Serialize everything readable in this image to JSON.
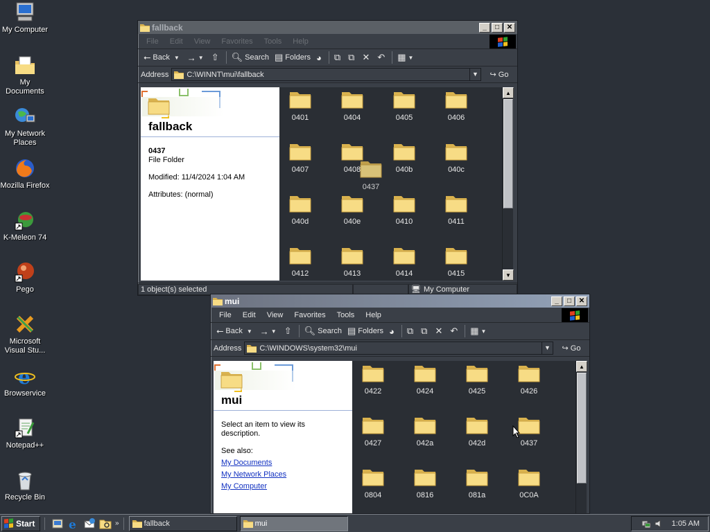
{
  "desktop": {
    "icons": [
      {
        "label": "My Computer",
        "icon": "my-computer-icon"
      },
      {
        "label": "My Documents",
        "icon": "my-documents-icon"
      },
      {
        "label": "My Network Places",
        "icon": "network-places-icon"
      },
      {
        "label": "Mozilla Firefox",
        "icon": "firefox-icon"
      },
      {
        "label": "K-Meleon 74",
        "icon": "k-meleon-icon"
      },
      {
        "label": "Pego",
        "icon": "pego-icon"
      },
      {
        "label": "Microsoft Visual Stu...",
        "icon": "visual-studio-icon"
      },
      {
        "label": "Browservice",
        "icon": "browservice-icon"
      },
      {
        "label": "Notepad++",
        "icon": "notepadpp-icon"
      },
      {
        "label": "Recycle Bin",
        "icon": "recycle-bin-icon"
      }
    ]
  },
  "win1": {
    "title": "fallback",
    "menu": [
      "File",
      "Edit",
      "View",
      "Favorites",
      "Tools",
      "Help"
    ],
    "toolbar": {
      "back": "Back",
      "search": "Search",
      "folders": "Folders"
    },
    "address_label": "Address",
    "address": "C:\\WINNT\\mui\\fallback",
    "go": "Go",
    "pane_title": "fallback",
    "selected_name": "0437",
    "selected_type": "File Folder",
    "modified": "Modified: 11/4/2024 1:04 AM",
    "attributes": "Attributes: (normal)",
    "folders": [
      "0401",
      "0404",
      "0405",
      "0406",
      "0407",
      "0408",
      "040b",
      "040c",
      "040d",
      "040e",
      "0410",
      "0411",
      "0412",
      "0413",
      "0414",
      "0415"
    ],
    "drag_folder": "0437",
    "status_left": "1 object(s) selected",
    "status_right": "My Computer"
  },
  "win2": {
    "title": "mui",
    "menu": [
      "File",
      "Edit",
      "View",
      "Favorites",
      "Tools",
      "Help"
    ],
    "toolbar": {
      "back": "Back",
      "search": "Search",
      "folders": "Folders"
    },
    "address_label": "Address",
    "address": "C:\\WINDOWS\\system32\\mui",
    "go": "Go",
    "pane_title": "mui",
    "description": "Select an item to view its description.",
    "see_also": "See also:",
    "links": [
      "My Documents",
      "My Network Places",
      "My Computer"
    ],
    "folders": [
      "0422",
      "0424",
      "0425",
      "0426",
      "0427",
      "042a",
      "042d",
      "0437",
      "0804",
      "0816",
      "081a",
      "0C0A"
    ]
  },
  "taskbar": {
    "start": "Start",
    "tasks": [
      "fallback",
      "mui"
    ],
    "time": "1:05 AM"
  },
  "colors": {
    "folder": "#f5d67a",
    "folder_dark": "#d9b24e",
    "accent": "#93a2b8"
  }
}
